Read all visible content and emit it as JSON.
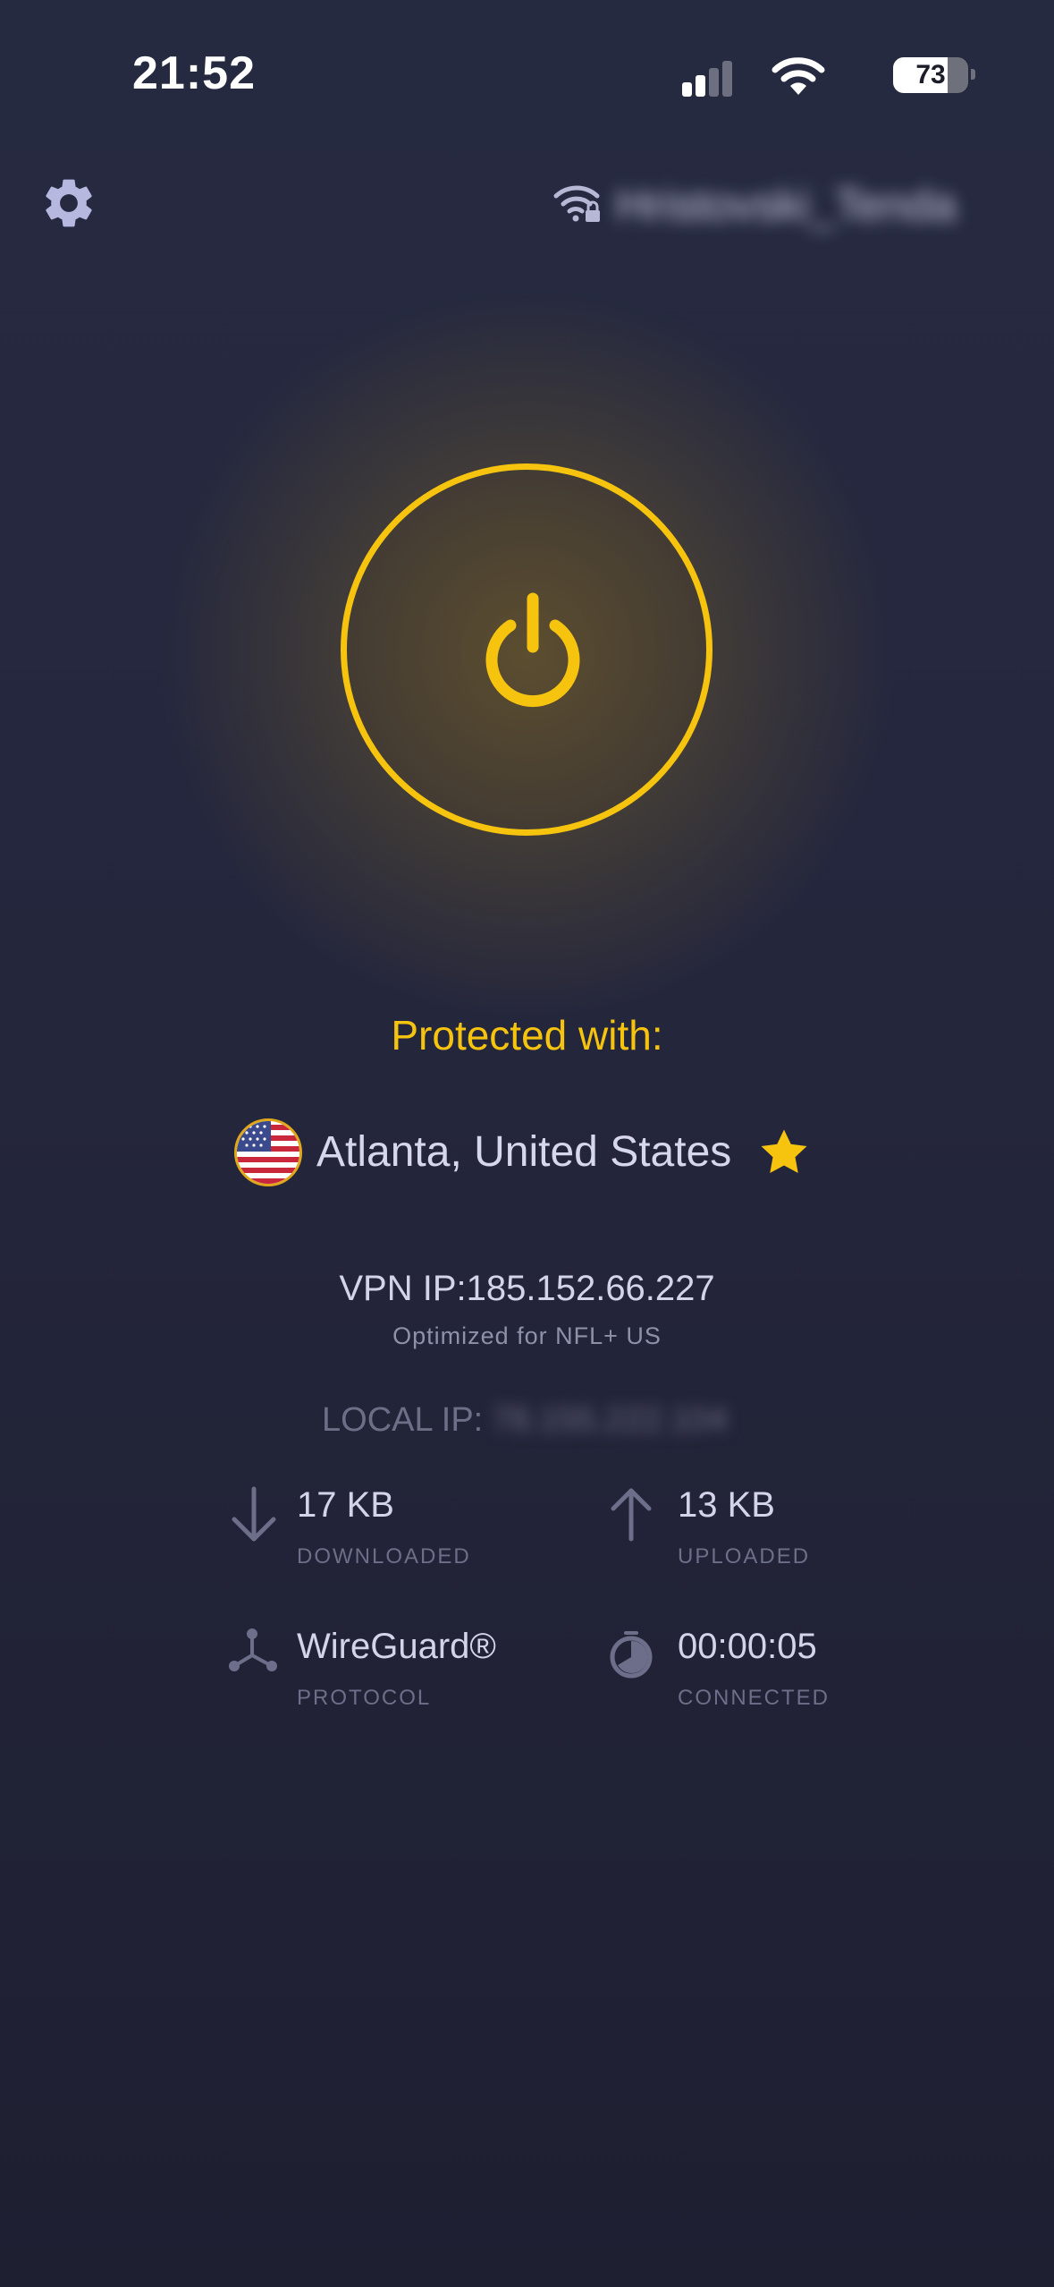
{
  "status_bar": {
    "time": "21:52",
    "signal_bars_active": 2,
    "signal_bars_total": 4,
    "battery_percent": 73,
    "battery_label": "73"
  },
  "top_bar": {
    "network_name": "Hristovski_Tenda"
  },
  "connection": {
    "status_label": "Protected with:",
    "location": "Atlanta, United States",
    "vpn_ip": "VPN IP:185.152.66.227",
    "optimized_note": "Optimized for NFL+ US",
    "local_ip_label": "LOCAL IP:",
    "local_ip_value": "78.155.222.104"
  },
  "stats": {
    "downloaded": {
      "value": "17 KB",
      "label": "DOWNLOADED"
    },
    "uploaded": {
      "value": "13 KB",
      "label": "UPLOADED"
    },
    "protocol": {
      "value": "WireGuard®",
      "label": "PROTOCOL"
    },
    "connected": {
      "value": "00:00:05",
      "label": "CONNECTED"
    }
  },
  "icons": {
    "settings": "gear-icon",
    "network": "wifi-lock-icon",
    "power": "power-icon",
    "flag": "us-flag-icon",
    "favorite": "star-icon",
    "download": "arrow-down-icon",
    "upload": "arrow-up-icon",
    "protocol": "protocol-nodes-icon",
    "timer": "stopwatch-icon"
  },
  "colors": {
    "accent": "#f6c40f",
    "background": "#24263c",
    "text": "#d3d4ea",
    "muted": "#6d6f8a"
  }
}
